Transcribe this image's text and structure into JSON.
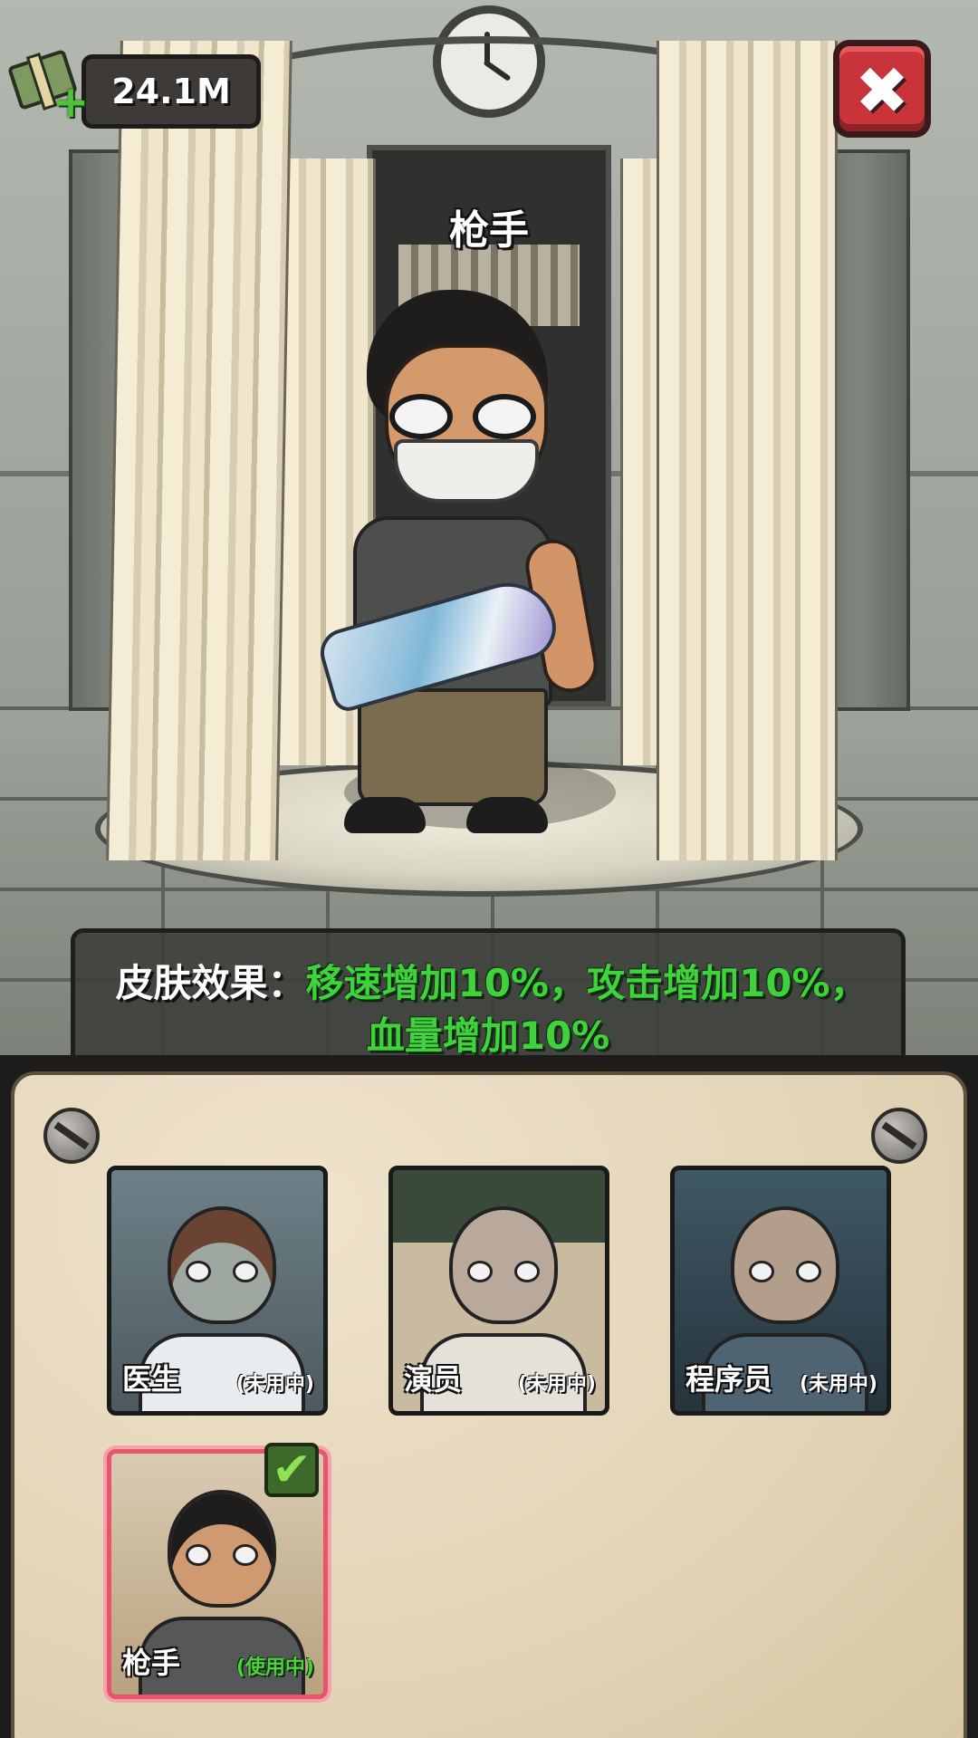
{
  "hud": {
    "currency_value": "24.1M",
    "currency_icon": "cash-stack-add-icon",
    "close_icon": "close-x-icon"
  },
  "stage": {
    "character_name": "枪手"
  },
  "skin_effect": {
    "label": "皮肤效果：",
    "line1_value": "移速增加10%，攻击增加10%，",
    "line2_value": "血量增加10%"
  },
  "skins": [
    {
      "name": "医生",
      "status": "(未用中)",
      "selected": false
    },
    {
      "name": "演员",
      "status": "(未用中)",
      "selected": false
    },
    {
      "name": "程序员",
      "status": "(未用中)",
      "selected": false
    },
    {
      "name": "枪手",
      "status": "(使用中)",
      "selected": true
    }
  ],
  "colors": {
    "effect_value": "#3fd23c",
    "close_button": "#c8343a",
    "selected_border": "#e8556a"
  }
}
